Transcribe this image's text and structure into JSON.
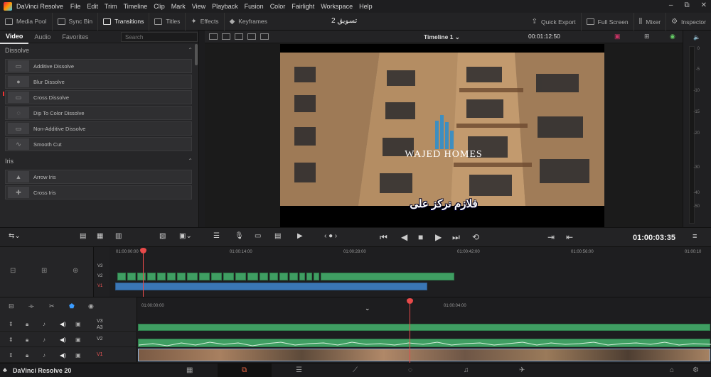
{
  "menubar": {
    "app_title": "DaVinci Resolve",
    "items": [
      "File",
      "Edit",
      "Trim",
      "Timeline",
      "Clip",
      "Mark",
      "View",
      "Playback",
      "Fusion",
      "Color",
      "Fairlight",
      "Workspace",
      "Help"
    ]
  },
  "toolbar": {
    "left": [
      {
        "label": "Media Pool",
        "active": false
      },
      {
        "label": "Sync Bin",
        "active": false
      },
      {
        "label": "Transitions",
        "active": true
      },
      {
        "label": "Titles",
        "active": false
      },
      {
        "label": "Effects",
        "active": false
      },
      {
        "label": "Keyframes",
        "active": false
      }
    ],
    "project_name": "تسويق 2",
    "right": [
      {
        "label": "Quick Export"
      },
      {
        "label": "Full Screen"
      },
      {
        "label": "Mixer"
      },
      {
        "label": "Inspector"
      }
    ]
  },
  "effects_panel": {
    "tabs": [
      {
        "label": "Video",
        "active": true
      },
      {
        "label": "Audio",
        "active": false
      },
      {
        "label": "Favorites",
        "active": false
      }
    ],
    "search_placeholder": "Search",
    "sections": [
      {
        "title": "Dissolve",
        "items": [
          "Additive Dissolve",
          "Blur Dissolve",
          "Cross Dissolve",
          "Dip To Color Dissolve",
          "Non-Additive Dissolve",
          "Smooth Cut"
        ]
      },
      {
        "title": "Iris",
        "items": [
          "Arrow Iris",
          "Cross Iris"
        ]
      }
    ]
  },
  "viewer": {
    "timeline_name": "Timeline 1",
    "timecode": "00:01:12:50",
    "overlay_brand": "WAJED HOMES",
    "subtitle": "فلازم نركز على"
  },
  "transport": {
    "timecode": "01:00:03:35"
  },
  "meter": {
    "db_labels": [
      "0",
      "-5",
      "-10",
      "-15",
      "-20",
      "-30",
      "-40",
      "-50"
    ]
  },
  "mini_timeline": {
    "ruler": [
      "01:00:00:00",
      "01:00:14:00",
      "01:00:28:00",
      "01:00:42:00",
      "01:00:56:00",
      "01:00:10"
    ],
    "tracks": [
      "V3",
      "V2",
      "V1"
    ]
  },
  "timeline": {
    "ruler": [
      "01:00:00:00",
      "01:00:04:00"
    ],
    "tracks": [
      {
        "label": "V3",
        "sub": "A3"
      },
      {
        "label": "V2",
        "sub": ""
      },
      {
        "label": "V1",
        "sub": ""
      }
    ]
  },
  "pagebar": {
    "brand": "DaVinci Resolve 20"
  },
  "colors": {
    "clip_green": "#3f9e62",
    "clip_blue": "#3a76b5",
    "playhead": "#e84a4a"
  }
}
